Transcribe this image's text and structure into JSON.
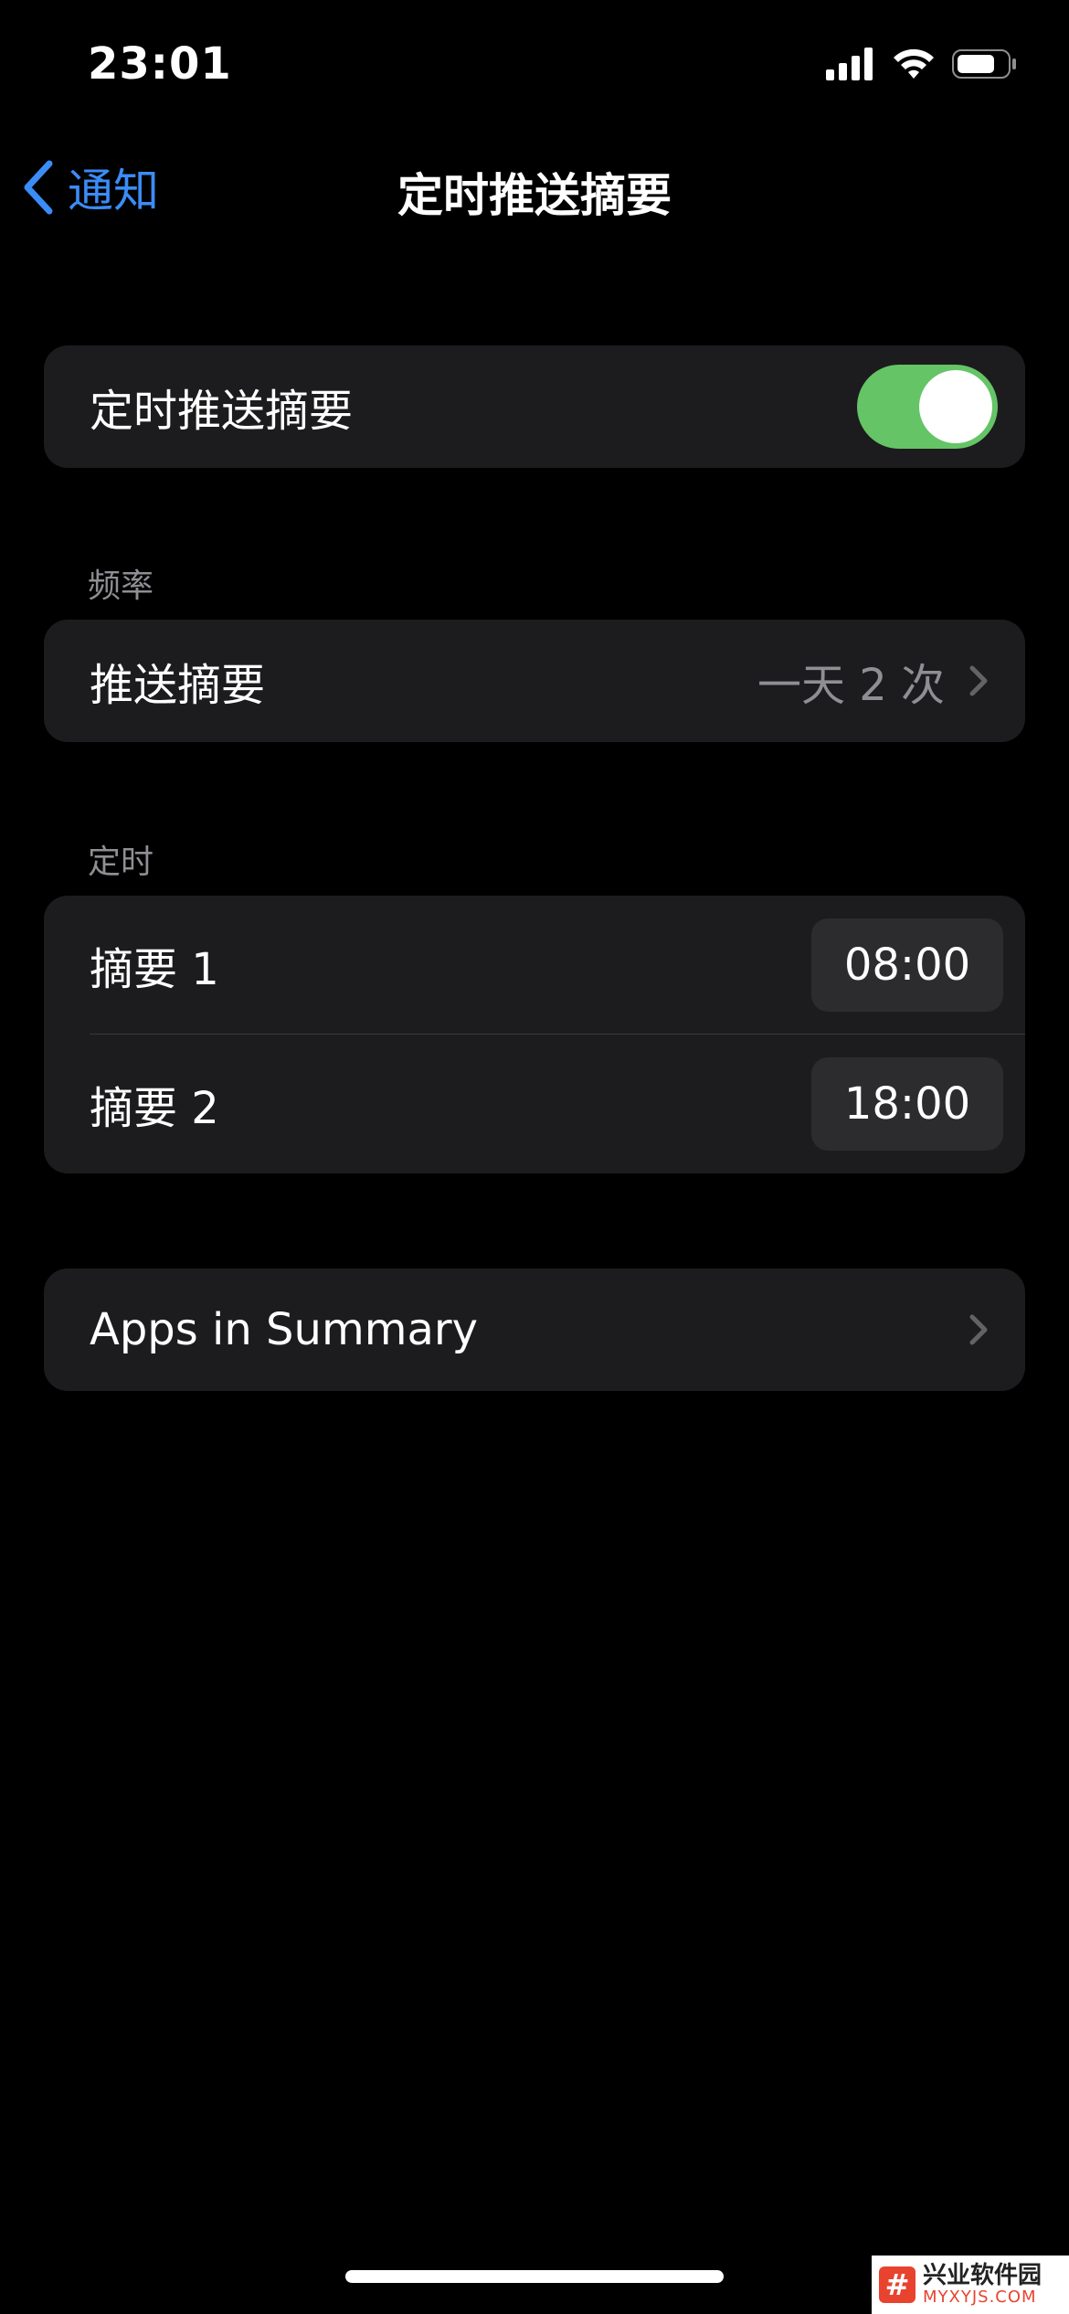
{
  "status_bar": {
    "time": "23:01",
    "icons": [
      "cellular-signal-icon",
      "wifi-icon",
      "battery-icon"
    ]
  },
  "nav": {
    "back_label": "通知",
    "title": "定时推送摘要"
  },
  "toggle_group": {
    "label": "定时推送摘要",
    "toggle_on": true,
    "toggle_color": "#65c466"
  },
  "frequency": {
    "header": "频率",
    "label": "推送摘要",
    "value": "一天 2 次"
  },
  "schedule": {
    "header": "定时",
    "items": [
      {
        "label": "摘要 1",
        "time": "08:00"
      },
      {
        "label": "摘要 2",
        "time": "18:00"
      }
    ]
  },
  "apps_summary": {
    "label": "Apps in Summary"
  },
  "watermark": {
    "logo_char": "#",
    "title": "兴业软件园",
    "subtitle": "MYXYJS.COM"
  },
  "colors": {
    "accent": "#3b8cf6",
    "background": "#000000",
    "cell": "#1c1c1e",
    "secondary_text": "#8e8e93"
  }
}
